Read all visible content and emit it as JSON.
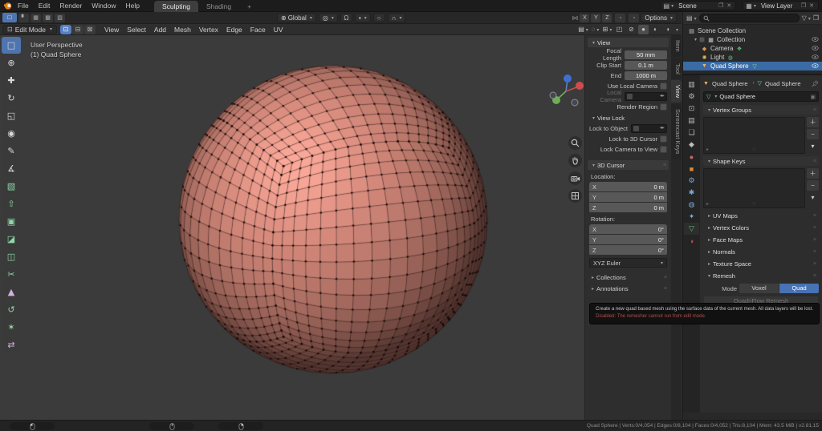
{
  "topbar": {
    "menus": [
      "File",
      "Edit",
      "Render",
      "Window",
      "Help"
    ],
    "tabs": [
      {
        "label": "Sculpting",
        "active": true
      },
      {
        "label": "Shading",
        "active": false
      },
      {
        "label": "+",
        "active": false
      }
    ],
    "scene_label": "Scene",
    "view_layer_label": "View Layer"
  },
  "tool_settings": {
    "orientation": "Global",
    "mirror_axes": [
      "X",
      "Y",
      "Z"
    ],
    "options_label": "Options"
  },
  "viewport_header": {
    "mode": "Edit Mode",
    "menus": [
      "View",
      "Select",
      "Add",
      "Mesh",
      "Vertex",
      "Edge",
      "Face",
      "UV"
    ]
  },
  "toolbar": {
    "tools": [
      {
        "name": "select-box",
        "glyph": "□",
        "active": true
      },
      {
        "name": "cursor",
        "glyph": "⊕"
      },
      {
        "name": "move",
        "glyph": "✚"
      },
      {
        "name": "rotate",
        "glyph": "↻"
      },
      {
        "name": "scale",
        "glyph": "◱"
      },
      {
        "name": "transform",
        "glyph": "◉"
      },
      {
        "name": "annotate",
        "glyph": "✎"
      },
      {
        "name": "measure",
        "glyph": "∡"
      },
      {
        "name": "add-cube",
        "glyph": "▧",
        "color": "#8fd6a8"
      },
      {
        "name": "extrude-region",
        "glyph": "⇧",
        "color": "#8fd6a8"
      },
      {
        "name": "inset-faces",
        "glyph": "▣",
        "color": "#8fd6a8"
      },
      {
        "name": "bevel",
        "glyph": "◪",
        "color": "#8fd6a8"
      },
      {
        "name": "loop-cut",
        "glyph": "◫",
        "color": "#8fd6a8"
      },
      {
        "name": "knife",
        "glyph": "✂",
        "color": "#8fd6a8"
      },
      {
        "name": "poly-build",
        "glyph": "▲",
        "color": "#d3b3e0"
      },
      {
        "name": "spin",
        "glyph": "↺",
        "color": "#8fd6a8"
      },
      {
        "name": "smooth",
        "glyph": "✶",
        "color": "#8fd6a8"
      },
      {
        "name": "edge-slide",
        "glyph": "⇄",
        "color": "#d3b3e0"
      }
    ]
  },
  "viewport": {
    "overlay_line1": "User Perspective",
    "overlay_line2": "(1) Quad Sphere"
  },
  "npanel": {
    "tabs": [
      {
        "label": "Item",
        "active": false
      },
      {
        "label": "Tool",
        "active": false
      },
      {
        "label": "View",
        "active": true
      },
      {
        "label": "Screencast Keys",
        "active": false
      }
    ],
    "view_panel": {
      "title": "View",
      "focal_label": "Focal Length",
      "focal_value": "50 mm",
      "clip_start_label": "Clip Start",
      "clip_start_value": "0.1 m",
      "clip_end_label": "End",
      "clip_end_value": "1000 m",
      "use_local_camera": "Use Local Camera",
      "local_camera": "Local Camera",
      "render_region": "Render Region"
    },
    "view_lock_panel": {
      "title": "View Lock",
      "lock_to_object": "Lock to Object",
      "lock_3d_cursor": "Lock to 3D Cursor",
      "lock_camera": "Lock Camera to View"
    },
    "cursor_panel": {
      "title": "3D Cursor",
      "location_label": "Location:",
      "rotation_label": "Rotation:",
      "loc": [
        {
          "axis": "X",
          "value": "0 m"
        },
        {
          "axis": "Y",
          "value": "0 m"
        },
        {
          "axis": "Z",
          "value": "0 m"
        }
      ],
      "rot": [
        {
          "axis": "X",
          "value": "0°"
        },
        {
          "axis": "Y",
          "value": "0°"
        },
        {
          "axis": "Z",
          "value": "0°"
        }
      ],
      "euler": "XYZ Euler"
    },
    "collections_title": "Collections",
    "annotations_title": "Annotations"
  },
  "outliner": {
    "root": "Scene Collection",
    "items": [
      {
        "label": "Collection",
        "selected": false
      },
      {
        "label": "Camera",
        "selected": false
      },
      {
        "label": "Light",
        "selected": false
      },
      {
        "label": "Quad Sphere",
        "selected": true
      }
    ]
  },
  "properties": {
    "tabs": [
      {
        "name": "editor-type",
        "glyph": "▥",
        "color": "#bdbdbd"
      },
      {
        "name": "tool",
        "glyph": "⚙",
        "color": "#bdbdbd"
      },
      {
        "name": "render",
        "glyph": "⊡",
        "color": "#bdbdbd"
      },
      {
        "name": "output",
        "glyph": "▤",
        "color": "#bdbdbd"
      },
      {
        "name": "view-layer",
        "glyph": "❏",
        "color": "#bdbdbd"
      },
      {
        "name": "scene",
        "glyph": "◆",
        "color": "#bdbdbd"
      },
      {
        "name": "world",
        "glyph": "●",
        "color": "#c46b6b"
      },
      {
        "name": "object",
        "glyph": "■",
        "color": "#e08b3d"
      },
      {
        "name": "modifiers",
        "glyph": "⚙",
        "color": "#7ba7d7"
      },
      {
        "name": "particles",
        "glyph": "✱",
        "color": "#7ba7d7"
      },
      {
        "name": "physics",
        "glyph": "◍",
        "color": "#7ba7d7"
      },
      {
        "name": "constraints",
        "glyph": "✦",
        "color": "#7ba7d7"
      },
      {
        "name": "object-data",
        "glyph": "▽",
        "color": "#5fbf7f",
        "active": true
      },
      {
        "name": "material",
        "glyph": "◑",
        "color": "#c4524e"
      }
    ],
    "breadcrumb_object": "Quad Sphere",
    "breadcrumb_data": "Quad Sphere",
    "name_value": "Quad Sphere",
    "vertex_groups_title": "Vertex Groups",
    "shape_keys_title": "Shape Keys",
    "collapsed_panels": [
      "UV Maps",
      "Vertex Colors",
      "Face Maps",
      "Normals",
      "Texture Space"
    ],
    "remesh": {
      "title": "Remesh",
      "mode_label": "Mode",
      "voxel": "Voxel",
      "quad": "Quad",
      "button": "QuadriFlow Remesh"
    }
  },
  "tooltip": {
    "line1": "Create a new quad based mesh using the surface data of the current mesh. All data layers will be lost.",
    "line2": "Disabled: The remesher cannot run from edit mode."
  },
  "statusbar": {
    "stats": "Quad Sphere | Verts:0/4,054 | Edges:0/8,104 | Faces:0/4,052 | Tris:8,104 | Mem: 43.5 MiB | v2.81.15"
  },
  "colors": {
    "accent": "#4772b3",
    "selection": "#3a6ba5",
    "mesh_base": "#d08678",
    "viewport_bg": "#3b3b3b"
  }
}
